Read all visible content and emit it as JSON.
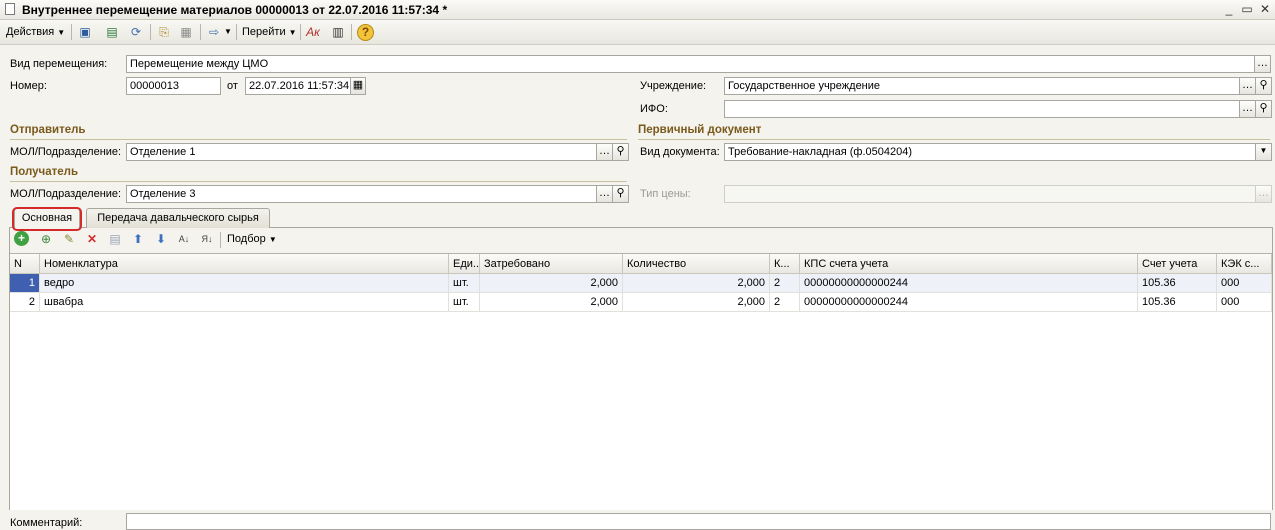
{
  "window": {
    "title": "Внутреннее перемещение материалов 00000013 от 22.07.2016 11:57:34 *",
    "controls": [
      "_",
      "▭",
      "✕"
    ]
  },
  "toolbar": {
    "actions_label": "Действия",
    "goto_label": "Перейти",
    "help_label": "?"
  },
  "form": {
    "movement_type_label": "Вид перемещения:",
    "movement_type_value": "Перемещение между ЦМО",
    "number_label": "Номер:",
    "number_value": "00000013",
    "date_from_label": "от",
    "date_value": "22.07.2016 11:57:34",
    "institution_label": "Учреждение:",
    "institution_value": "Государственное учреждение",
    "ifo_label": "ИФО:",
    "ifo_value": "",
    "sender_section": "Отправитель",
    "sender_mol_label": "МОЛ/Подразделение:",
    "sender_mol_value": "Отделение 1",
    "receiver_section": "Получатель",
    "receiver_mol_label": "МОЛ/Подразделение:",
    "receiver_mol_value": "Отделение 3",
    "primary_doc_section": "Первичный документ",
    "doc_type_label": "Вид документа:",
    "doc_type_value": "Требование-накладная (ф.0504204)",
    "price_type_label": "Тип цены:",
    "price_type_value": "",
    "comment_label": "Комментарий:",
    "comment_value": ""
  },
  "tabs": [
    {
      "label": "Основная",
      "active": true
    },
    {
      "label": "Передача давальческого сырья",
      "active": false
    }
  ],
  "table_toolbar": {
    "selection_label": "Подбор"
  },
  "table": {
    "columns": [
      "N",
      "Номенклатура",
      "Еди...",
      "Затребовано",
      "Количество",
      "К...",
      "КПС счета учета",
      "Счет учета",
      "КЭК с..."
    ],
    "rows": [
      {
        "n": "1",
        "item": "ведро",
        "unit": "шт.",
        "requested": "2,000",
        "quantity": "2,000",
        "k": "2",
        "kps": "00000000000000244",
        "account": "105.36",
        "kek": "000"
      },
      {
        "n": "2",
        "item": "швабра",
        "unit": "шт.",
        "requested": "2,000",
        "quantity": "2,000",
        "k": "2",
        "kps": "00000000000000244",
        "account": "105.36",
        "kek": "000"
      }
    ]
  },
  "colors": {
    "section_title": "#7a5a1b",
    "highlight_ring": "#d52a2a",
    "selected_cell": "#3f5fb0"
  }
}
